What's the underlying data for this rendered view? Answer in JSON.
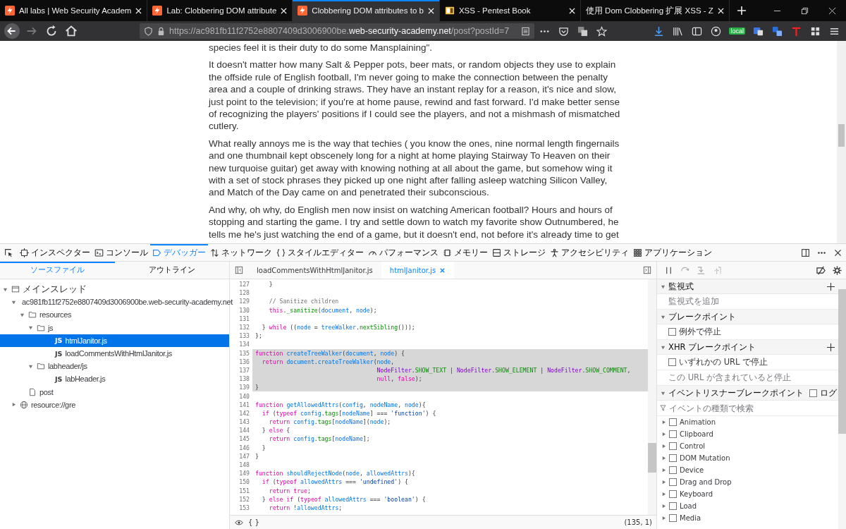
{
  "browser_tabs": [
    {
      "title": "All labs | Web Security Academ",
      "selected": false
    },
    {
      "title": "Lab: Clobbering DOM attribute",
      "selected": false
    },
    {
      "title": "Clobbering DOM attributes to b",
      "selected": true
    },
    {
      "title": "XSS - Pentest Book",
      "selected": false
    },
    {
      "title": "使用 Dom Clobbering 扩展 XSS - Z",
      "selected": false
    }
  ],
  "url": {
    "host_prefix": "https://ac981fb11f2752e8807409d3006900be.",
    "domain": "web-security-academy.net",
    "path": "/post?postId=7"
  },
  "extension_badge": "local",
  "article": {
    "paragraphs": [
      "species feel it is their duty to do some Mansplaining\".",
      "It doesn't matter how many Salt & Pepper pots, beer mats, or random objects they use to explain the offside rule of English football, I'm never going to make the connection between the penalty area and a couple of drinking straws. They have an instant replay for a reason, it's nice and slow, just point to the television; if you're at home pause, rewind and fast forward. I'd make better sense of recognizing the players' positions if I could see the players, and not a mishmash of mismatched cutlery.",
      "What really annoys me is the way that techies ( you know the ones, nine normal length fingernails and one thumbnail kept obscenely long for a night at home playing Stairway To Heaven on their new turquoise guitar) get away with knowing nothing at all about the game, but somehow wing it with a set of stock phrases they picked up one night after falling asleep watching Silicon Valley, and Match of the Day came on and penetrated their subconscious.",
      "And why, oh why, do English men now insist on watching American football? Hours and hours of stopping and starting the game. I try and settle down to watch my favorite show Outnumbered, he tells me he's just watching the end of a game, but it doesn't end, not before it's already time to get"
    ]
  },
  "devtools_tabs": [
    {
      "label": "インスペクター",
      "selected": false
    },
    {
      "label": "コンソール",
      "selected": false
    },
    {
      "label": "デバッガー",
      "selected": true
    },
    {
      "label": "ネットワーク",
      "selected": false
    },
    {
      "label": "スタイルエディター",
      "selected": false
    },
    {
      "label": "パフォーマンス",
      "selected": false
    },
    {
      "label": "メモリー",
      "selected": false
    },
    {
      "label": "ストレージ",
      "selected": false
    },
    {
      "label": "アクセシビリティ",
      "selected": false
    },
    {
      "label": "アプリケーション",
      "selected": false
    }
  ],
  "sources_tabs": [
    {
      "label": "ソースファイル",
      "selected": true
    },
    {
      "label": "アウトライン",
      "selected": false
    }
  ],
  "tree": [
    {
      "kind": "thread",
      "label": "メインスレッド",
      "expanded": true,
      "selected": false,
      "children": [
        {
          "kind": "domain",
          "label": "ac981fb11f2752e8807409d3006900be.web-security-academy.net",
          "expanded": true,
          "selected": false,
          "children": [
            {
              "kind": "folder",
              "label": "resources",
              "expanded": true,
              "selected": false,
              "children": [
                {
                  "kind": "folder",
                  "label": "js",
                  "expanded": true,
                  "selected": false,
                  "children": [
                    {
                      "kind": "script",
                      "badge": "JS",
                      "label": "htmlJanitor.js",
                      "selected": true
                    },
                    {
                      "kind": "script",
                      "badge": "JS",
                      "label": "loadCommentsWithHtmlJanitor.js",
                      "selected": false
                    }
                  ]
                },
                {
                  "kind": "folder",
                  "label": "labheader/js",
                  "expanded": true,
                  "selected": false,
                  "children": [
                    {
                      "kind": "script",
                      "badge": "JS",
                      "label": "labHeader.js",
                      "selected": false
                    }
                  ]
                }
              ]
            },
            {
              "kind": "page",
              "label": "post",
              "selected": false
            }
          ]
        },
        {
          "kind": "domain",
          "label": "resource://gre",
          "expanded": false,
          "selected": false
        }
      ]
    }
  ],
  "editor_tabs": [
    {
      "label": "loadCommentsWithHtmlJanitor.js",
      "selected": false,
      "closable": false
    },
    {
      "label": "htmlJanitor.js",
      "selected": true,
      "closable": true
    }
  ],
  "code": [
    {
      "num": "127",
      "highlighted": false,
      "tokens": [
        {
          "kind": "plain",
          "text": "    }"
        }
      ]
    },
    {
      "num": "128",
      "highlighted": false
    },
    {
      "num": "129",
      "highlighted": false,
      "tokens": [
        {
          "kind": "comment",
          "text": "    // Sanitize children"
        }
      ]
    },
    {
      "num": "130",
      "highlighted": false,
      "tokens": [
        {
          "kind": "keyword",
          "text": "    this"
        },
        {
          "kind": "plain",
          "text": "."
        },
        {
          "kind": "prop",
          "text": "_sanitize"
        },
        {
          "kind": "plain",
          "text": "("
        },
        {
          "kind": "ident",
          "text": "document"
        },
        {
          "kind": "plain",
          "text": ", "
        },
        {
          "kind": "ident",
          "text": "node"
        },
        {
          "kind": "plain",
          "text": ");"
        }
      ]
    },
    {
      "num": "131",
      "highlighted": false
    },
    {
      "num": "132",
      "highlighted": false,
      "tokens": [
        {
          "kind": "plain",
          "text": "  } "
        },
        {
          "kind": "keyword",
          "text": "while"
        },
        {
          "kind": "plain",
          "text": " (("
        },
        {
          "kind": "ident",
          "text": "node"
        },
        {
          "kind": "plain",
          "text": " = "
        },
        {
          "kind": "ident",
          "text": "treeWalker"
        },
        {
          "kind": "plain",
          "text": "."
        },
        {
          "kind": "prop",
          "text": "nextSibling"
        },
        {
          "kind": "plain",
          "text": "()));"
        }
      ]
    },
    {
      "num": "133",
      "highlighted": false,
      "tokens": [
        {
          "kind": "plain",
          "text": "};"
        }
      ]
    },
    {
      "num": "134",
      "highlighted": false
    },
    {
      "num": "135",
      "highlighted": true,
      "tokens": [
        {
          "kind": "keyword",
          "text": "function "
        },
        {
          "kind": "ident",
          "text": "createTreeWalker"
        },
        {
          "kind": "plain",
          "text": "("
        },
        {
          "kind": "ident",
          "text": "document"
        },
        {
          "kind": "plain",
          "text": ", "
        },
        {
          "kind": "ident",
          "text": "node"
        },
        {
          "kind": "plain",
          "text": ") {"
        }
      ]
    },
    {
      "num": "136",
      "highlighted": true,
      "tokens": [
        {
          "kind": "keyword",
          "text": "  return "
        },
        {
          "kind": "ident",
          "text": "document"
        },
        {
          "kind": "plain",
          "text": "."
        },
        {
          "kind": "ident",
          "text": "createTreeWalker"
        },
        {
          "kind": "plain",
          "text": "("
        },
        {
          "kind": "ident",
          "text": "node"
        },
        {
          "kind": "plain",
          "text": ","
        }
      ]
    },
    {
      "num": "137",
      "highlighted": true,
      "tokens": [
        {
          "kind": "class",
          "text": "                                   NodeFilter"
        },
        {
          "kind": "plain",
          "text": "."
        },
        {
          "kind": "prop",
          "text": "SHOW_TEXT"
        },
        {
          "kind": "plain",
          "text": " | "
        },
        {
          "kind": "class",
          "text": "NodeFilter"
        },
        {
          "kind": "plain",
          "text": "."
        },
        {
          "kind": "prop",
          "text": "SHOW_ELEMENT"
        },
        {
          "kind": "plain",
          "text": " | "
        },
        {
          "kind": "class",
          "text": "NodeFilter"
        },
        {
          "kind": "plain",
          "text": "."
        },
        {
          "kind": "prop",
          "text": "SHOW_COMMENT"
        },
        {
          "kind": "plain",
          "text": ","
        }
      ]
    },
    {
      "num": "138",
      "highlighted": true,
      "tokens": [
        {
          "kind": "keyword",
          "text": "                                   null"
        },
        {
          "kind": "plain",
          "text": ", "
        },
        {
          "kind": "keyword",
          "text": "false"
        },
        {
          "kind": "plain",
          "text": ");"
        }
      ]
    },
    {
      "num": "139",
      "highlighted": true,
      "tokens": [
        {
          "kind": "plain",
          "text": "}"
        }
      ]
    },
    {
      "num": "140",
      "highlighted": false
    },
    {
      "num": "141",
      "highlighted": false,
      "tokens": [
        {
          "kind": "keyword",
          "text": "function "
        },
        {
          "kind": "ident",
          "text": "getAllowedAttrs"
        },
        {
          "kind": "plain",
          "text": "("
        },
        {
          "kind": "ident",
          "text": "config"
        },
        {
          "kind": "plain",
          "text": ", "
        },
        {
          "kind": "ident",
          "text": "nodeName"
        },
        {
          "kind": "plain",
          "text": ", "
        },
        {
          "kind": "ident",
          "text": "node"
        },
        {
          "kind": "plain",
          "text": "){"
        }
      ]
    },
    {
      "num": "142",
      "highlighted": false,
      "tokens": [
        {
          "kind": "keyword",
          "text": "  if"
        },
        {
          "kind": "plain",
          "text": " ("
        },
        {
          "kind": "keyword",
          "text": "typeof "
        },
        {
          "kind": "ident",
          "text": "config"
        },
        {
          "kind": "plain",
          "text": "."
        },
        {
          "kind": "prop",
          "text": "tags"
        },
        {
          "kind": "plain",
          "text": "["
        },
        {
          "kind": "ident",
          "text": "nodeName"
        },
        {
          "kind": "plain",
          "text": "] === "
        },
        {
          "kind": "string",
          "text": "'function'"
        },
        {
          "kind": "plain",
          "text": ") {"
        }
      ]
    },
    {
      "num": "143",
      "highlighted": false,
      "tokens": [
        {
          "kind": "keyword",
          "text": "    return "
        },
        {
          "kind": "ident",
          "text": "config"
        },
        {
          "kind": "plain",
          "text": "."
        },
        {
          "kind": "prop",
          "text": "tags"
        },
        {
          "kind": "plain",
          "text": "["
        },
        {
          "kind": "ident",
          "text": "nodeName"
        },
        {
          "kind": "plain",
          "text": "]("
        },
        {
          "kind": "ident",
          "text": "node"
        },
        {
          "kind": "plain",
          "text": ");"
        }
      ]
    },
    {
      "num": "144",
      "highlighted": false,
      "tokens": [
        {
          "kind": "plain",
          "text": "  } "
        },
        {
          "kind": "keyword",
          "text": "else"
        },
        {
          "kind": "plain",
          "text": " {"
        }
      ]
    },
    {
      "num": "145",
      "highlighted": false,
      "tokens": [
        {
          "kind": "keyword",
          "text": "    return "
        },
        {
          "kind": "ident",
          "text": "config"
        },
        {
          "kind": "plain",
          "text": "."
        },
        {
          "kind": "prop",
          "text": "tags"
        },
        {
          "kind": "plain",
          "text": "["
        },
        {
          "kind": "ident",
          "text": "nodeName"
        },
        {
          "kind": "plain",
          "text": "];"
        }
      ]
    },
    {
      "num": "146",
      "highlighted": false,
      "tokens": [
        {
          "kind": "plain",
          "text": "  }"
        }
      ]
    },
    {
      "num": "147",
      "highlighted": false,
      "tokens": [
        {
          "kind": "plain",
          "text": "}"
        }
      ]
    },
    {
      "num": "148",
      "highlighted": false
    },
    {
      "num": "149",
      "highlighted": false,
      "tokens": [
        {
          "kind": "keyword",
          "text": "function "
        },
        {
          "kind": "ident",
          "text": "shouldRejectNode"
        },
        {
          "kind": "plain",
          "text": "("
        },
        {
          "kind": "ident",
          "text": "node"
        },
        {
          "kind": "plain",
          "text": ", "
        },
        {
          "kind": "ident",
          "text": "allowedAttrs"
        },
        {
          "kind": "plain",
          "text": "){"
        }
      ]
    },
    {
      "num": "150",
      "highlighted": false,
      "tokens": [
        {
          "kind": "keyword",
          "text": "  if"
        },
        {
          "kind": "plain",
          "text": " ("
        },
        {
          "kind": "keyword",
          "text": "typeof "
        },
        {
          "kind": "ident",
          "text": "allowedAttrs"
        },
        {
          "kind": "plain",
          "text": " === "
        },
        {
          "kind": "string",
          "text": "'undefined'"
        },
        {
          "kind": "plain",
          "text": ") {"
        }
      ]
    },
    {
      "num": "151",
      "highlighted": false,
      "tokens": [
        {
          "kind": "keyword",
          "text": "    return true"
        },
        {
          "kind": "plain",
          "text": ";"
        }
      ]
    },
    {
      "num": "152",
      "highlighted": false,
      "tokens": [
        {
          "kind": "plain",
          "text": "  } "
        },
        {
          "kind": "keyword",
          "text": "else if"
        },
        {
          "kind": "plain",
          "text": " ("
        },
        {
          "kind": "keyword",
          "text": "typeof "
        },
        {
          "kind": "ident",
          "text": "allowedAttrs"
        },
        {
          "kind": "plain",
          "text": " === "
        },
        {
          "kind": "string",
          "text": "'boolean'"
        },
        {
          "kind": "plain",
          "text": ") {"
        }
      ]
    },
    {
      "num": "153",
      "highlighted": false,
      "tokens": [
        {
          "kind": "keyword",
          "text": "    return"
        },
        {
          "kind": "plain",
          "text": " !"
        },
        {
          "kind": "ident",
          "text": "allowedAttrs"
        },
        {
          "kind": "plain",
          "text": ";"
        }
      ]
    }
  ],
  "editor_status": {
    "pretty_print": "{ }",
    "cursor": "(135, 1)"
  },
  "sidebar_sections": [
    {
      "title": "監視式",
      "expanded": true,
      "add": true,
      "items": [
        {
          "kind": "hint",
          "text": "監視式を追加"
        }
      ]
    },
    {
      "title": "ブレークポイント",
      "expanded": true,
      "add": false,
      "items": [
        {
          "kind": "checkbox",
          "label": "例外で停止",
          "checked": false
        }
      ]
    },
    {
      "title": "XHR ブレークポイント",
      "expanded": true,
      "add": true,
      "items": [
        {
          "kind": "checkbox",
          "label": "いずれかの URL で停止",
          "checked": false
        },
        {
          "kind": "hint",
          "text": "この URL が含まれていると停止"
        }
      ]
    },
    {
      "title": "イベントリスナーブレークポイント",
      "expanded": true,
      "add": false,
      "log": {
        "label": "ログ",
        "checked": false
      },
      "items": [
        {
          "kind": "search",
          "placeholder": "イベントの種類で検索"
        },
        {
          "kind": "event",
          "label": "Animation",
          "checked": false,
          "expanded": false
        },
        {
          "kind": "event",
          "label": "Clipboard",
          "checked": false,
          "expanded": false
        },
        {
          "kind": "event",
          "label": "Control",
          "checked": false,
          "expanded": false
        },
        {
          "kind": "event",
          "label": "DOM Mutation",
          "checked": false,
          "expanded": false
        },
        {
          "kind": "event",
          "label": "Device",
          "checked": false,
          "expanded": false
        },
        {
          "kind": "event",
          "label": "Drag and Drop",
          "checked": false,
          "expanded": false
        },
        {
          "kind": "event",
          "label": "Keyboard",
          "checked": false,
          "expanded": false
        },
        {
          "kind": "event",
          "label": "Load",
          "checked": false,
          "expanded": false
        },
        {
          "kind": "event",
          "label": "Media",
          "checked": false,
          "expanded": false
        }
      ]
    }
  ]
}
